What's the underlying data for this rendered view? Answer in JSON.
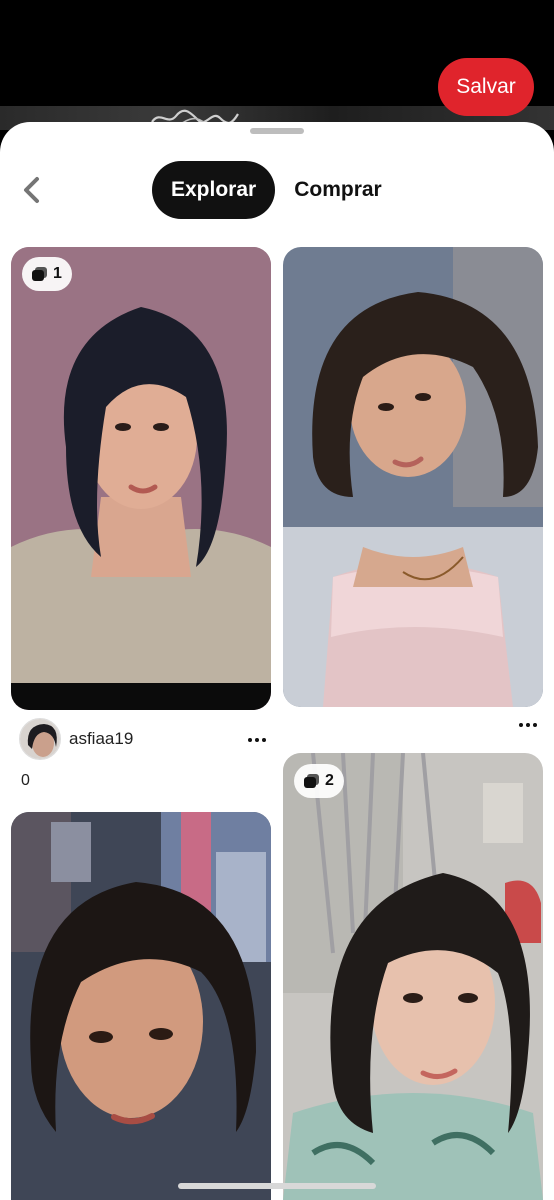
{
  "header": {
    "save_label": "Salvar"
  },
  "tabs": [
    {
      "label": "Explorar",
      "active": true
    },
    {
      "label": "Comprar",
      "active": false
    }
  ],
  "pins": [
    {
      "badge_count": "1"
    },
    {
      "badge_count": null
    },
    {
      "badge_count": null
    },
    {
      "badge_count": "2"
    }
  ],
  "pin_meta": {
    "username": "asfiaa19",
    "count": "0"
  },
  "colors": {
    "save_red": "#e0242c",
    "active_tab": "#111111"
  },
  "icons": [
    "chevron-left-icon",
    "more-dots-icon",
    "multi-image-stack-icon"
  ]
}
